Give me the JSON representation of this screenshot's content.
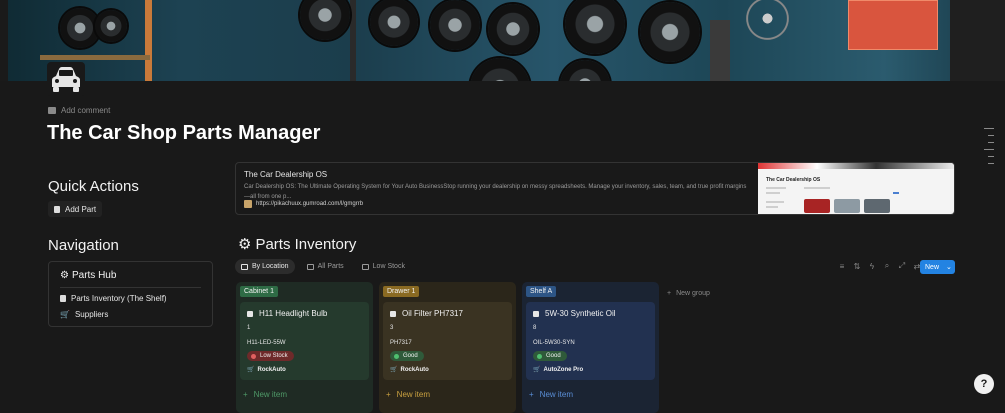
{
  "page": {
    "add_comment": "Add comment",
    "title": "The Car Shop Parts Manager"
  },
  "quick_actions": {
    "heading": "Quick Actions",
    "add_part": "Add Part"
  },
  "navigation": {
    "heading": "Navigation",
    "hub": "Parts Hub",
    "links": [
      "Parts Inventory (The Shelf)",
      "Suppliers"
    ]
  },
  "bookmark": {
    "title": "The Car Dealership OS",
    "description": "Car Dealership OS: The Ultimate Operating System for Your Auto BusinessStop running your dealership on messy spreadsheets. Manage your inventory, sales, team, and true profit margins—all from one p...",
    "url": "https://pikachuux.gumroad.com/l/gmgrrb",
    "thumb_title": "The Car Dealership OS"
  },
  "database": {
    "title": "Parts Inventory",
    "tabs": [
      "By Location",
      "All Parts",
      "Low Stock"
    ],
    "new_button": "New",
    "new_group": "New group",
    "new_item": "New item",
    "columns": [
      {
        "label": "Cabinet 1",
        "card": {
          "name": "H11 Headlight Bulb",
          "qty": "1",
          "part_no": "H11-LED-55W",
          "status": "Low Stock",
          "supplier": "RockAuto"
        }
      },
      {
        "label": "Drawer 1",
        "card": {
          "name": "Oil Filter PH7317",
          "qty": "3",
          "part_no": "PH7317",
          "status": "Good",
          "supplier": "RockAuto"
        }
      },
      {
        "label": "Shelf A",
        "card": {
          "name": "5W-30 Synthetic Oil",
          "qty": "8",
          "part_no": "OIL-5W30-SYN",
          "status": "Good",
          "supplier": "AutoZone Pro"
        }
      }
    ]
  },
  "help": {
    "label": "?"
  },
  "colors": {
    "accent": "#2383e2",
    "green_col": "#1f2b24",
    "yellow_col": "#2b261a",
    "blue_col": "#1b2433",
    "low_stock": "#c04a4a",
    "good": "#2f7a46"
  }
}
